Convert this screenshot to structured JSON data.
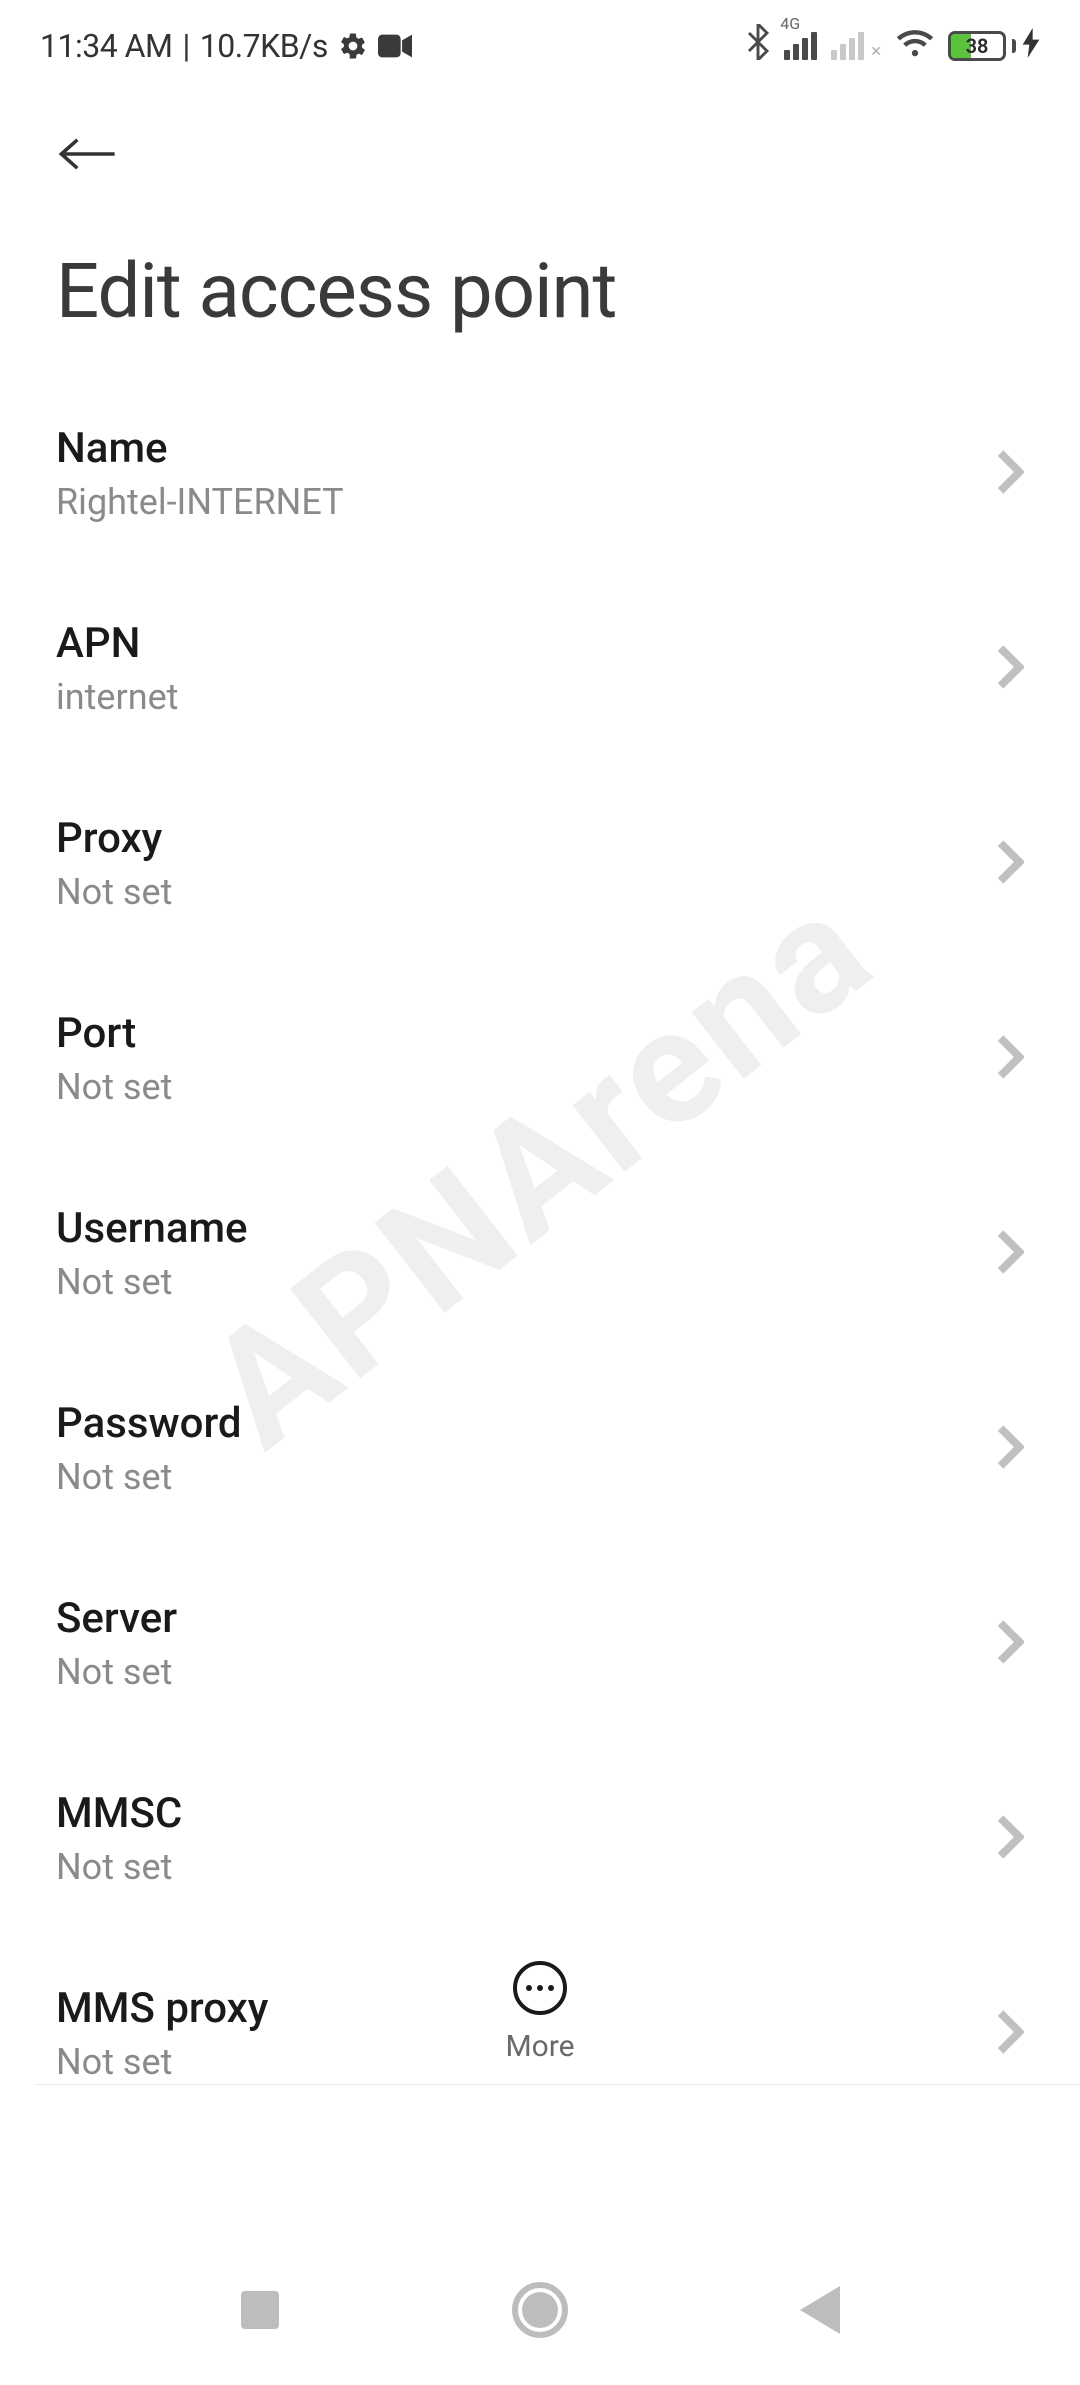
{
  "statusBar": {
    "time": "11:34 AM",
    "separator": "|",
    "netSpeed": "10.7KB/s",
    "network4g": "4G",
    "sim2x": "✕",
    "batteryPct": "38",
    "bolt": "⚡"
  },
  "header": {
    "title": "Edit access point"
  },
  "items": [
    {
      "label": "Name",
      "value": "Rightel-INTERNET"
    },
    {
      "label": "APN",
      "value": "internet"
    },
    {
      "label": "Proxy",
      "value": "Not set"
    },
    {
      "label": "Port",
      "value": "Not set"
    },
    {
      "label": "Username",
      "value": "Not set"
    },
    {
      "label": "Password",
      "value": "Not set"
    },
    {
      "label": "Server",
      "value": "Not set"
    },
    {
      "label": "MMSC",
      "value": "Not set"
    },
    {
      "label": "MMS proxy",
      "value": "Not set"
    }
  ],
  "more": {
    "label": "More"
  },
  "watermark": "APNArena"
}
